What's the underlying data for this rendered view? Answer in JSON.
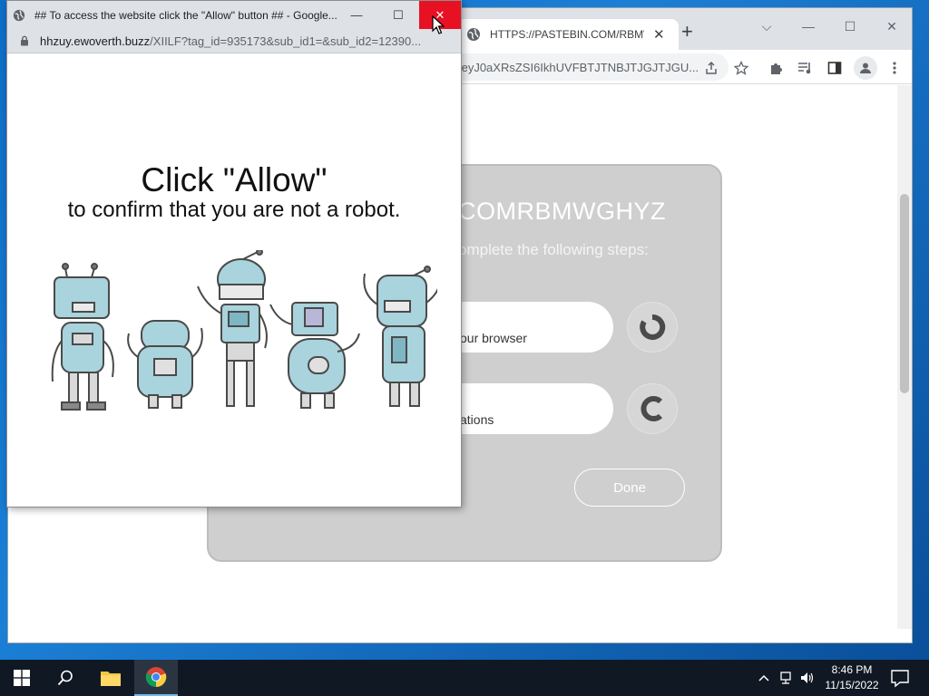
{
  "main_window": {
    "tab_title": "HTTPS://PASTEBIN.COM/RBMWGHYZ",
    "tab_close": "✕",
    "new_tab": "+",
    "url": "=eyJ0aXRsZSI6IkhUVFBTJTNBJTJGJTJGU...",
    "caption": {
      "dropdown": "⌵",
      "minimize": "—",
      "maximize": "☐",
      "close": "✕"
    }
  },
  "card": {
    "title": "COMRBMWGHYZ",
    "subtitle": "omplete the following steps:",
    "step1": "our browser",
    "step2": "ations",
    "done_label": "Done"
  },
  "popup": {
    "title": "## To access the website click the \"Allow\" button ## - Google...",
    "url_host": "hhzuy.ewoverth.buzz",
    "url_path": "/XIILF?tag_id=935173&sub_id1=&sub_id2=12390...",
    "heading": "Click \"Allow\"",
    "subheading": "to confirm that you are not a robot.",
    "minimize": "—",
    "maximize": "☐",
    "close": "✕"
  },
  "taskbar": {
    "time": "8:46 PM",
    "date": "11/15/2022"
  },
  "icons": {
    "globe": "globe-icon",
    "lock": "lock-icon",
    "share": "share-icon",
    "star": "star-icon",
    "extensions": "puzzle-icon",
    "media": "media-icon",
    "sidepanel": "side-panel-icon",
    "profile": "profile-icon",
    "menu": "kebab-menu-icon"
  },
  "colors": {
    "close_red": "#e81123",
    "card_gray": "#cfcfcf",
    "taskbar": "#101923"
  }
}
